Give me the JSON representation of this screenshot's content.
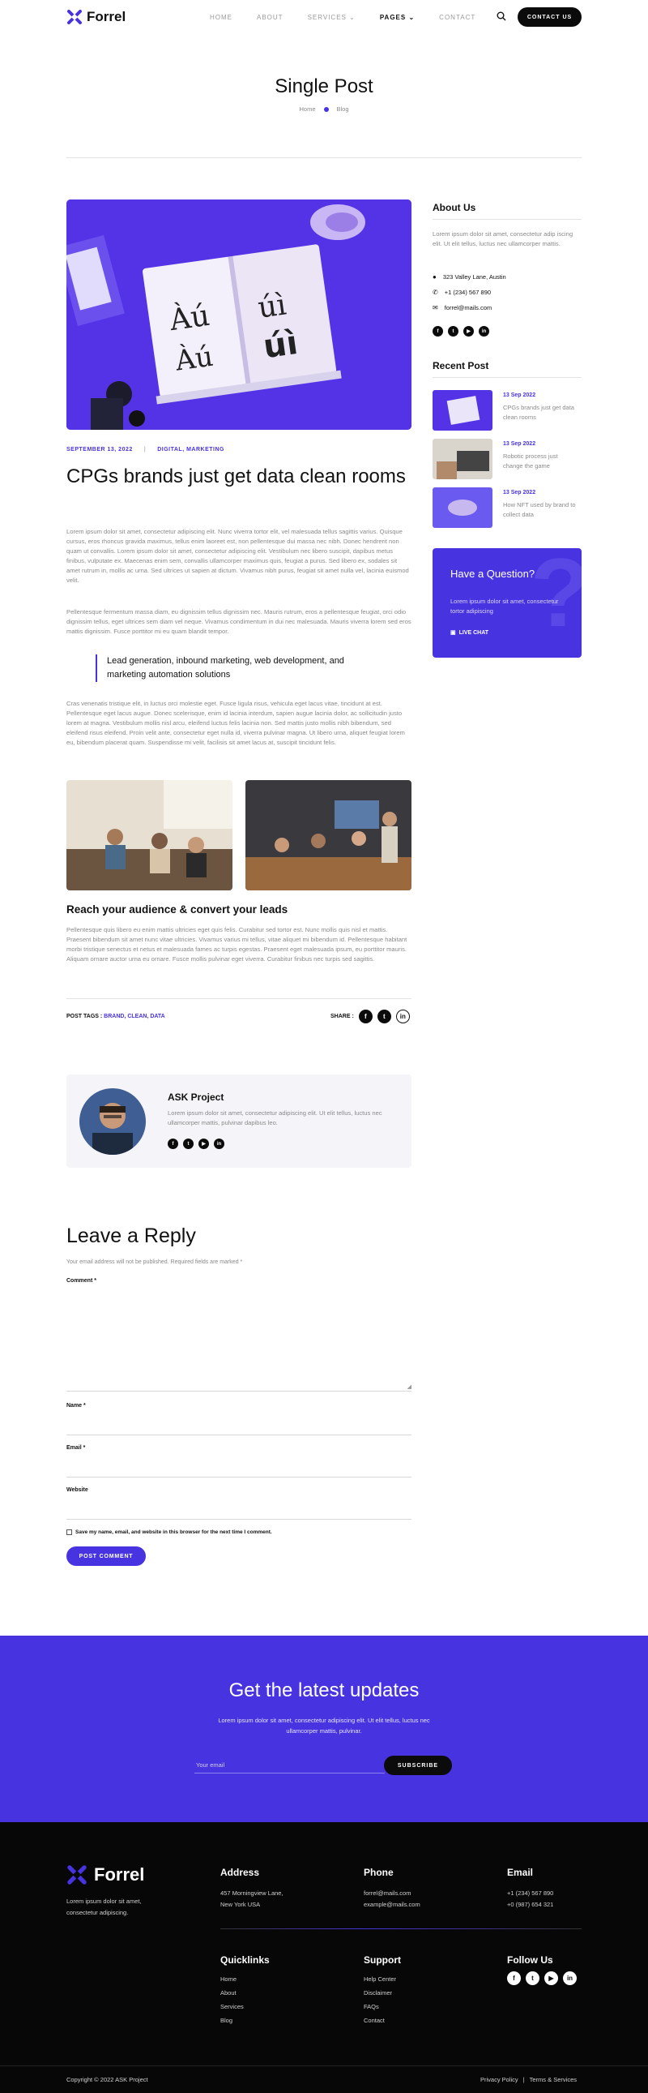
{
  "header": {
    "logo": "Forrel",
    "nav": [
      "HOME",
      "ABOUT",
      "SERVICES",
      "PAGES",
      "CONTACT"
    ],
    "cta": "CONTACT US"
  },
  "hero": {
    "title": "Single Post",
    "breadcrumb": [
      "Home",
      "Blog"
    ]
  },
  "post": {
    "date": "SEPTEMBER 13, 2022",
    "categories": "DIGITAL, MARKETING",
    "title": "CPGs brands just get data clean rooms",
    "para1": "Lorem ipsum dolor sit amet, consectetur adipiscing elit. Nunc viverra tortor elit, vel malesuada tellus sagittis varius. Quisque cursus, eros rhoncus gravida maximus, tellus enim laoreet est, non pellentesque dui massa nec nibh. Donec hendrerit non quam ut convallis. Lorem ipsum dolor sit amet, consectetur adipiscing elit. Vestibulum nec libero suscipit, dapibus metus finibus, vulputate ex. Maecenas enim sem, convallis ullamcorper maximus quis, feugiat a purus. Sed libero ex, sodales sit amet rutrum in, mollis ac urna. Sed ultrices ut sapien at dictum. Vivamus nibh purus, feugiat sit amet nulla vel, lacinia euismod velit.",
    "para2": "Pellentesque fermentum massa diam, eu dignissim tellus dignissim nec. Mauris rutrum, eros a pellentesque feugiat, orci odio dignissim tellus, eget ultrices sem diam vel neque. Vivamus condimentum in dui nec malesuada. Mauris viverra lorem sed eros mattis dignissim. Fusce porttitor mi eu quam blandit tempor.",
    "quote": "Lead generation, inbound marketing, web development, and marketing automation solutions",
    "para3": "Cras venenatis tristique elit, in luctus orci molestie eget. Fusce ligula risus, vehicula eget lacus vitae, tincidunt at est. Pellentesque eget lacus augue. Donec scelerisque, enim id lacinia interdum, sapien augue lacinia dolor, ac sollicitudin justo lorem at magna. Vestibulum mollis nisl arcu, eleifend luctus felis lacinia non. Sed mattis justo mollis nibh bibendum, sed eleifend risus eleifend. Proin velit ante, consectetur eget nulla id, viverra pulvinar magna. Ut libero urna, aliquet feugiat lorem eu, bibendum placerat quam. Suspendisse mi velit, facilisis sit amet lacus at, suscipit tincidunt felis.",
    "subheading": "Reach your audience & convert your leads",
    "para4": "Pellentesque quis libero eu enim mattis ultricies eget quis felis. Curabitur sed tortor est. Nunc mollis quis nisl et mattis. Praesent bibendum sit amet nunc vitae ultricies. Vivamus varius mi tellus, vitae aliquet mi bibendum id. Pellentesque habitant morbi tristique senectus et netus et malesuada fames ac turpis egestas. Praesent eget malesuada ipsum, eu porttitor mauris. Aliquam ornare auctor urna eu ornare. Fusce mollis pulvinar eget viverra. Curabitur finibus nec turpis sed sagittis.",
    "tags_label": "POST TAGS :",
    "tags": "BRAND, CLEAN, DATA",
    "share_label": "SHARE :"
  },
  "author": {
    "name": "ASK Project",
    "bio": "Lorem ipsum dolor sit amet, consectetur adipiscing elit. Ut elit tellus, luctus nec ullamcorper mattis, pulvinar dapibus leo."
  },
  "reply": {
    "title": "Leave a Reply",
    "note": "Your email address will not be published. Required fields are marked *",
    "comment_label": "Comment *",
    "name_label": "Name *",
    "email_label": "Email *",
    "website_label": "Website",
    "save_label": "Save my name, email, and website in this browser for the next time I comment.",
    "submit": "POST COMMENT"
  },
  "sidebar": {
    "about_title": "About Us",
    "about_text": "Lorem ipsum dolor sit amet, consectetur adip iscing elit. Ut elit tellus, luctus nec ullamcorper mattis.",
    "address": "323 Valley Lane, Austin",
    "phone": "+1 (234) 567 890",
    "email": "forrel@mails.com",
    "recent_title": "Recent Post",
    "recent": [
      {
        "date": "13 Sep 2022",
        "title": "CPGs brands just get data clean rooms"
      },
      {
        "date": "13 Sep 2022",
        "title": "Robotic process just change the game"
      },
      {
        "date": "13 Sep 2022",
        "title": "How NFT used by brand to collect data"
      }
    ],
    "question_title": "Have a Question?",
    "question_text": "Lorem ipsum dolor sit amet, consectetur tortor adipiscing",
    "question_cta": "LIVE CHAT"
  },
  "newsletter": {
    "title": "Get the latest updates",
    "text": "Lorem ipsum dolor sit amet, consectetur adipiscing elit. Ut elit tellus, luctus nec ullamcorper mattis, pulvinar.",
    "placeholder": "Your email",
    "button": "SUBSCRIBE"
  },
  "footer": {
    "logo": "Forrel",
    "tagline": "Lorem ipsum dolor sit amet, consectetur adipiscing.",
    "address_title": "Address",
    "address": [
      "457 Morningview Lane,",
      "New York USA"
    ],
    "phone_title": "Phone",
    "phone": [
      "forrel@mails.com",
      "example@mails.com"
    ],
    "email_title": "Email",
    "email": [
      "+1 (234) 567 890",
      "+0 (987) 654 321"
    ],
    "quicklinks_title": "Quicklinks",
    "quicklinks": [
      "Home",
      "About",
      "Services",
      "Blog"
    ],
    "support_title": "Support",
    "support": [
      "Help Center",
      "Disclaimer",
      "FAQs",
      "Contact"
    ],
    "follow_title": "Follow Us",
    "copyright": "Copyright © 2022 ASK Project",
    "privacy": "Privacy Policy",
    "terms": "Terms & Services"
  },
  "colors": {
    "accent": "#4733e0",
    "dark": "#0b0b0b"
  }
}
